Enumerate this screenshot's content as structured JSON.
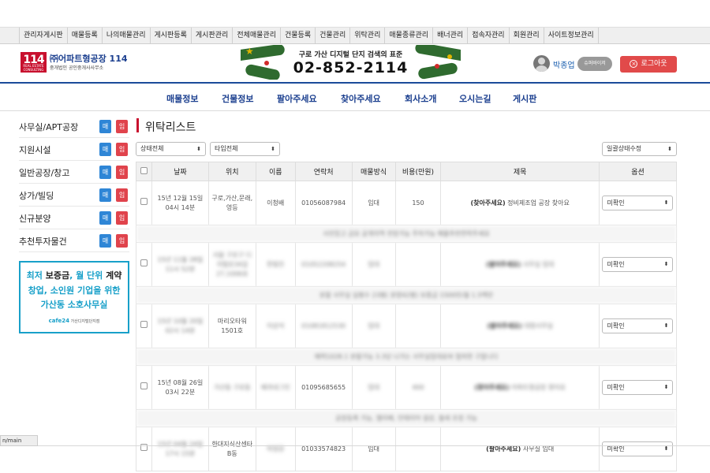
{
  "admin_menu": [
    "관리자게시판",
    "매물등록",
    "나의매물관리",
    "게시판등록",
    "게시판관리",
    "전체매물관리",
    "건물등록",
    "건물관리",
    "위탁관리",
    "매물종류관리",
    "배너관리",
    "접속자관리",
    "회원관리",
    "사이트정보관리"
  ],
  "logo": {
    "mark": "114",
    "mark_sub": "REAL ESTATE CONSULTING",
    "name": "㈜어파트형공장 114",
    "sub": "중개법인 공인중개사사무소"
  },
  "banner": {
    "title": "구로 가산 디지털 단지 검색의 표준",
    "phone": "02-852-2114"
  },
  "user": {
    "name": "박종업",
    "role": "슈퍼바이저",
    "logout": "로그아웃"
  },
  "main_nav": [
    "매물정보",
    "건물정보",
    "팔아주세요",
    "찾아주세요",
    "회사소개",
    "오시는길",
    "게시판"
  ],
  "sidebar": {
    "buy_label": "매",
    "rent_label": "임",
    "items": [
      {
        "label": "사무실/APT공장"
      },
      {
        "label": "지원시설"
      },
      {
        "label": "일반공장/창고"
      },
      {
        "label": "상가/빌딩"
      },
      {
        "label": "신규분양"
      },
      {
        "label": "추천투자물건"
      }
    ]
  },
  "ad": {
    "line1_a": "최저 ",
    "line1_b": "보증금",
    "line1_c": ", 월 단위 ",
    "line1_d": "계약",
    "line2": "창업, 소인원 기업을 위한",
    "line3": "가산동 소호사무실",
    "footer_brand": "cafe24",
    "footer_text": "가산디지털단지점"
  },
  "list": {
    "title": "위탁리스트",
    "filter_status": "상태전체",
    "filter_type": "타입전체",
    "bulk_action": "일괄상태수정",
    "columns": [
      "날짜",
      "위치",
      "이름",
      "연락처",
      "매물방식",
      "비용(만원)",
      "제목",
      "옵션"
    ],
    "rows": [
      {
        "date": "15년 12월 15일 04시 14분",
        "location": "구로,가산,문래,영등",
        "name": "이청배",
        "phone": "01056087984",
        "type": "임대",
        "cost": "150",
        "title_tag": "(찾아주세요)",
        "title": "정비제조업 공장 찾아요",
        "status": "미확인",
        "note": "사진있고 금요 공개지역 전망가능 주차가능 매물추천연락주세요"
      },
      {
        "date": "15년 11월 28일 11시 52분",
        "location": "서울 구로구 디지털로34길 27,1006호",
        "name": "한빛진",
        "phone": "01052208254",
        "type": "임대",
        "cost": "",
        "title_tag": "(팔아주세요)",
        "title": "사무실 임대",
        "status": "미확인",
        "note": "분할 사무실 실평수 23평( 분양42평) 보증금 1500만/월 1.5백만"
      },
      {
        "date": "15년 10월 20일 02시 14분",
        "location": "마리오타워 1501호",
        "name": "이상석",
        "phone": "01081812530",
        "type": "임대",
        "cost": "",
        "title_tag": "(팔아주세요)",
        "title": "대형사무실",
        "status": "미확인",
        "note": "매력1028.1 분할가능 3.3당 나가는 사무실임대료와 협의한 구합니다"
      },
      {
        "date": "15년 08월 26일 03시 22분",
        "location": "가산동 구로동",
        "name": "배과네그인",
        "phone": "01095685655",
        "type": "임대",
        "cost": "400",
        "title_tag": "(찾아주세요)",
        "title": "아파트형공장 찾아요",
        "status": "미확인",
        "note": "공장등록 가능, 엘리베, 인테리어 설강, 월세 조정 가능"
      },
      {
        "date": "15년 04월 24일 17시 15분",
        "location": "한대지식산센타 B동",
        "name": "박정감",
        "phone": "01033574823",
        "type": "임대",
        "cost": "",
        "title_tag": "(팔아주세요)",
        "title": "사무실 임대",
        "status": "미확인",
        "note": ""
      }
    ]
  },
  "status_url": "n/main",
  "colors": {
    "brand_blue": "#1b3f8f",
    "accent_red": "#c8102e",
    "buy_blue": "#2f86d6",
    "rent_red": "#e0434c",
    "ad_cyan": "#18a0c9",
    "logout_red": "#e14a4a"
  },
  "icons": {
    "logout": "close-circle-icon",
    "caret": "chevron-updown-icon",
    "avatar": "user-avatar-icon"
  }
}
